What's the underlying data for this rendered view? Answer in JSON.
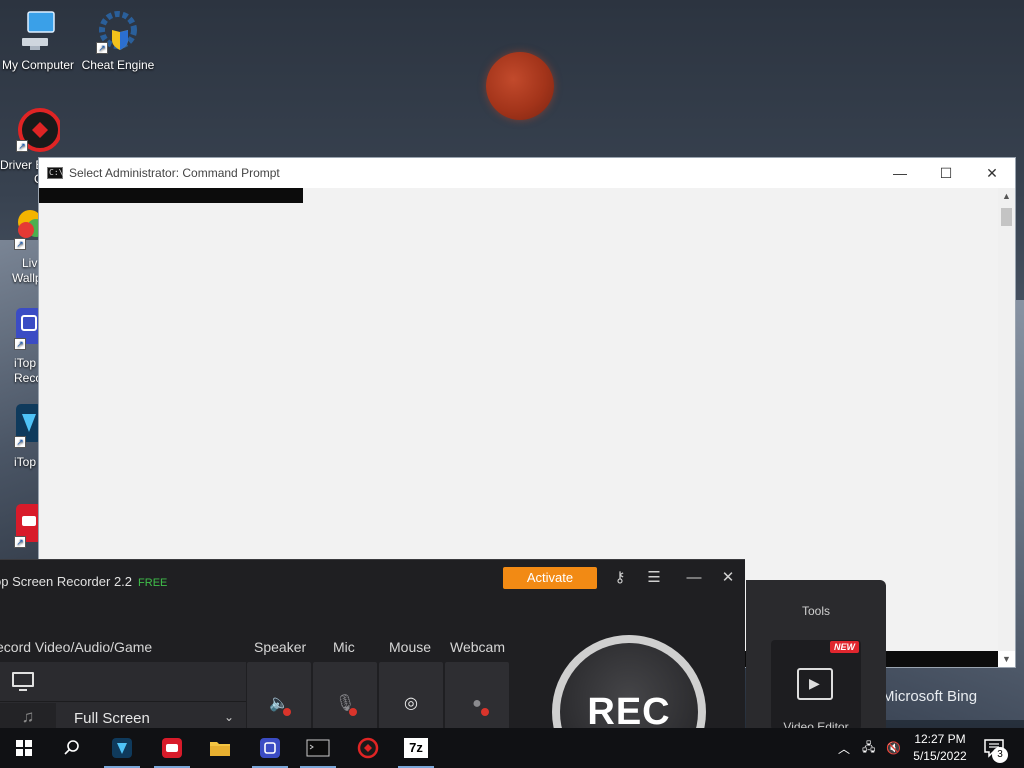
{
  "desktop": {
    "icons": [
      {
        "label": "My Computer"
      },
      {
        "label": "Cheat Engine"
      }
    ],
    "partial_labels": [
      "Driver B",
      "G",
      "Liv",
      "Wallp",
      "iTop",
      "Reco",
      "iTop"
    ],
    "wallpaper_credit": "Microsoft Bing"
  },
  "cmd": {
    "title": "Select Administrator: Command Prompt",
    "icon_text": "C:\\",
    "minimize": "—",
    "maximize": "☐",
    "close": "✕"
  },
  "recorder": {
    "title": "op Screen Recorder 2.2",
    "free": "FREE",
    "activate": "Activate",
    "section_mode": "ecord Video/Audio/Game",
    "speaker": "Speaker",
    "mic": "Mic",
    "mouse": "Mouse",
    "webcam": "Webcam",
    "mode_value": "Full Screen",
    "rec_label": "REC"
  },
  "tools": {
    "title": "Tools",
    "badge": "NEW",
    "video_editor": "Video Editor"
  },
  "taskbar": {
    "time": "12:27 PM",
    "date": "5/15/2022",
    "notification_count": "3",
    "seven_zip": "7z"
  },
  "colors": {
    "accent_orange": "#f28a14",
    "free_green": "#3fbe4a",
    "new_red": "#e0262e"
  }
}
